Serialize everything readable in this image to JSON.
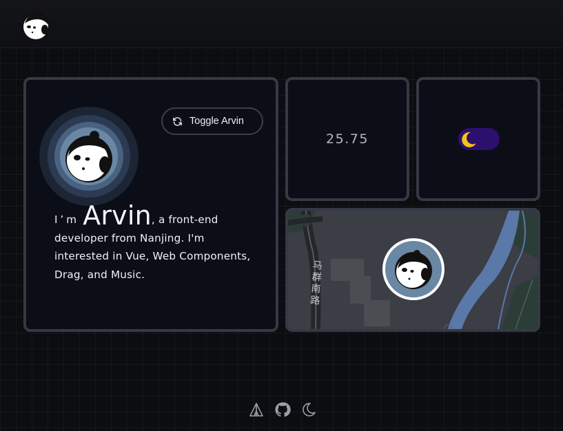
{
  "header": {
    "logo_icon": "mascot-logo-icon"
  },
  "profile": {
    "toggle_label": "Toggle Arvin",
    "toggle_icon": "refresh-icon",
    "intro_prefix": "I’m",
    "name": "Arvin",
    "intro_rest": ", a front-end developer from Nanjing. I'm interested in Vue, Web Components, Drag, and Music."
  },
  "stat": {
    "value": "25.75"
  },
  "theme_switch": {
    "icon": "moon-icon",
    "state": "dark"
  },
  "map": {
    "road_label": "马群南路",
    "marker_icon": "mascot-avatar-icon"
  },
  "footer": {
    "icons": [
      "tent-icon",
      "github-icon",
      "moon-icon"
    ]
  },
  "colors": {
    "background": "#0c0d10",
    "card": "#0b0e16",
    "card_border": "#353945",
    "switch_track": "#2d0f6e",
    "moon": "#f5c518",
    "river": "#5a78a8"
  }
}
